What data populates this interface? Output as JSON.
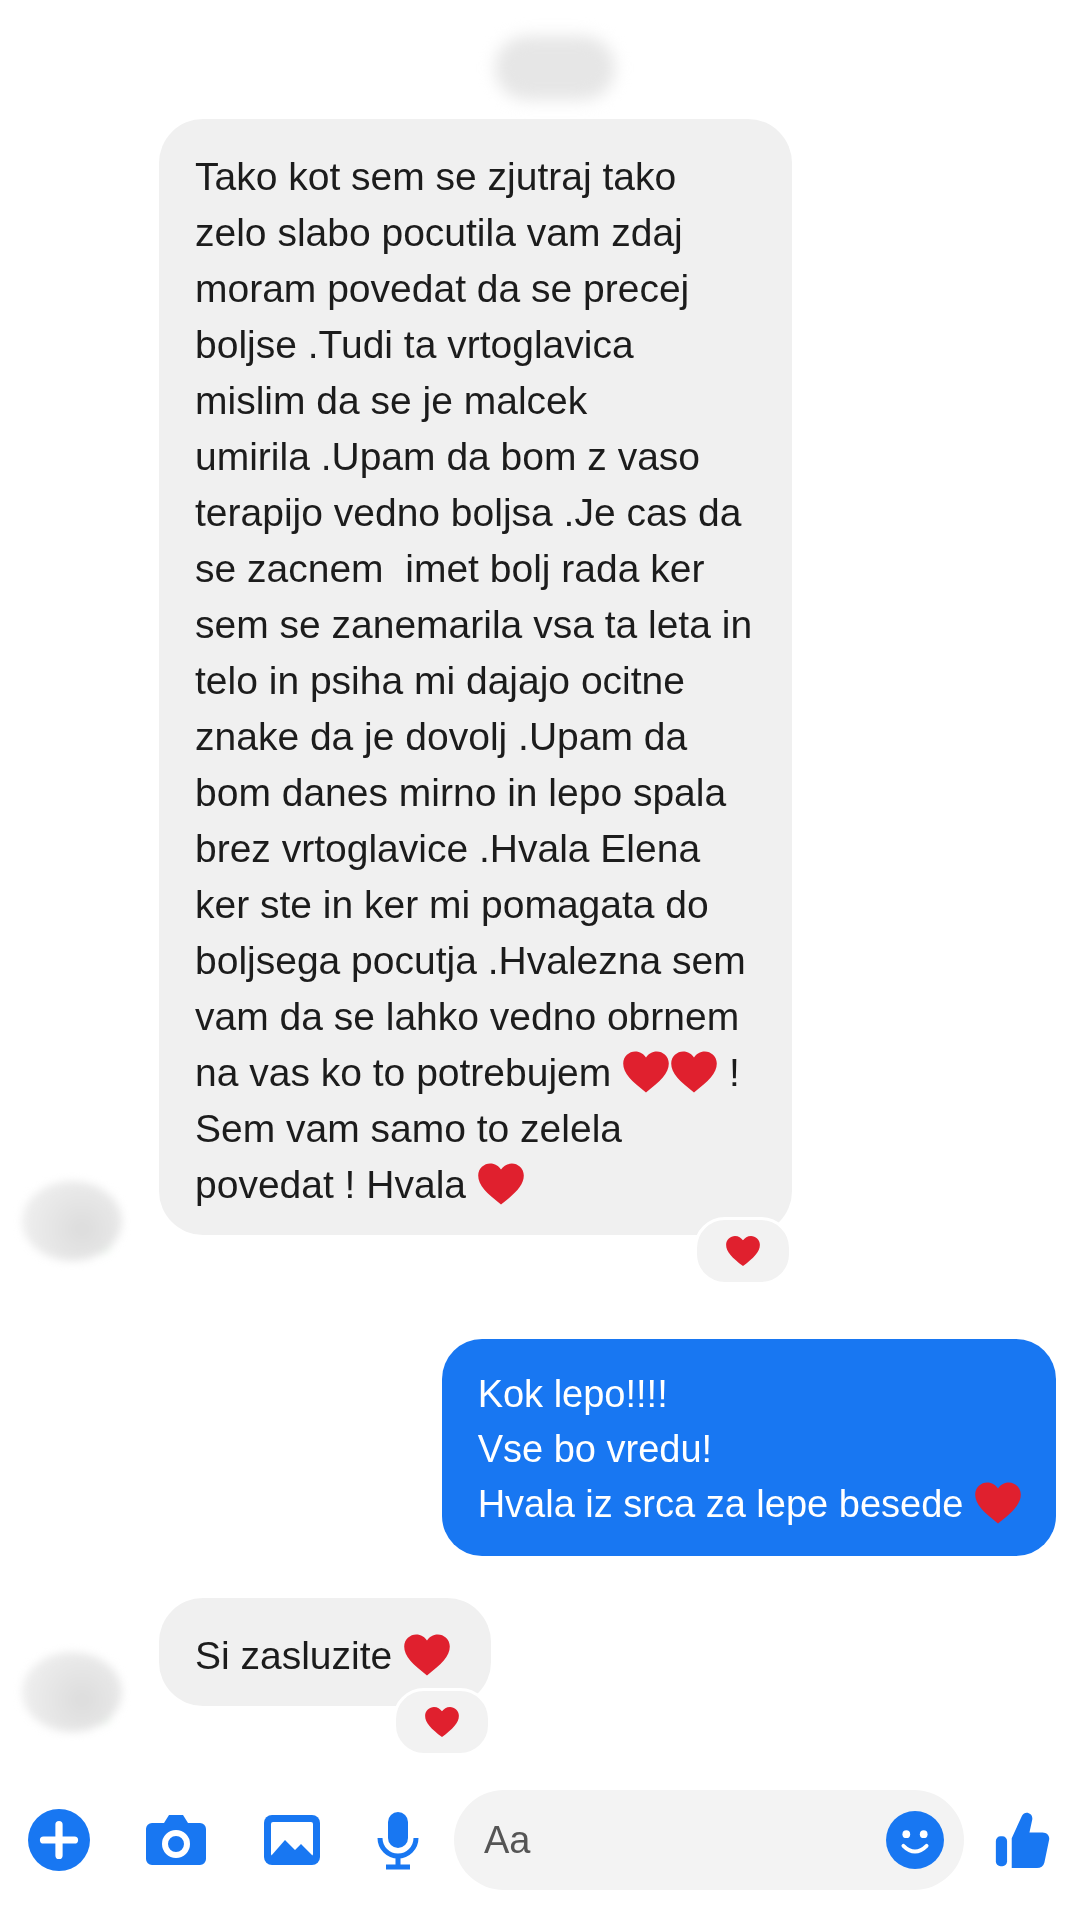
{
  "messages": [
    {
      "outgoing": false,
      "avatar": true,
      "parts": [
        {
          "kind": "text",
          "text": "Tako kot sem se zjutraj tako\nzelo slabo pocutila vam zdaj\nmoram povedat da se precej\nboljse .Tudi ta vrtoglavica\nmislim da se je malcek\numirila .Upam da bom z vaso\nterapijo vedno boljsa .Je cas da\nse zacnem  imet bolj rada ker\nsem se zanemarila vsa ta leta in\ntelo in psiha mi dajajo ocitne\nznake da je dovolj .Upam da\nbom danes mirno in lepo spala\nbrez vrtoglavice .Hvala Elena\nker ste in ker mi pomagata do\nboljsega pocutja .Hvalezna sem\nvam da se lahko vedno obrnem\nna vas ko to potrebujem "
        },
        {
          "kind": "heart"
        },
        {
          "kind": "heart"
        },
        {
          "kind": "text",
          "text": " !\nSem vam samo to zelela\npovedat ! Hvala "
        },
        {
          "kind": "heart"
        }
      ],
      "reacted": true
    },
    {
      "outgoing": true,
      "avatar": false,
      "parts": [
        {
          "kind": "text",
          "text": "Kok lepo!!!!\nVse bo vredu!\nHvala iz srca za lepe besede "
        },
        {
          "kind": "heart"
        }
      ],
      "reacted": false
    },
    {
      "outgoing": false,
      "avatar": true,
      "parts": [
        {
          "kind": "text",
          "text": "Si zasluzite "
        },
        {
          "kind": "heart"
        }
      ],
      "reacted": true
    }
  ],
  "composer": {
    "placeholder": "Aa"
  }
}
